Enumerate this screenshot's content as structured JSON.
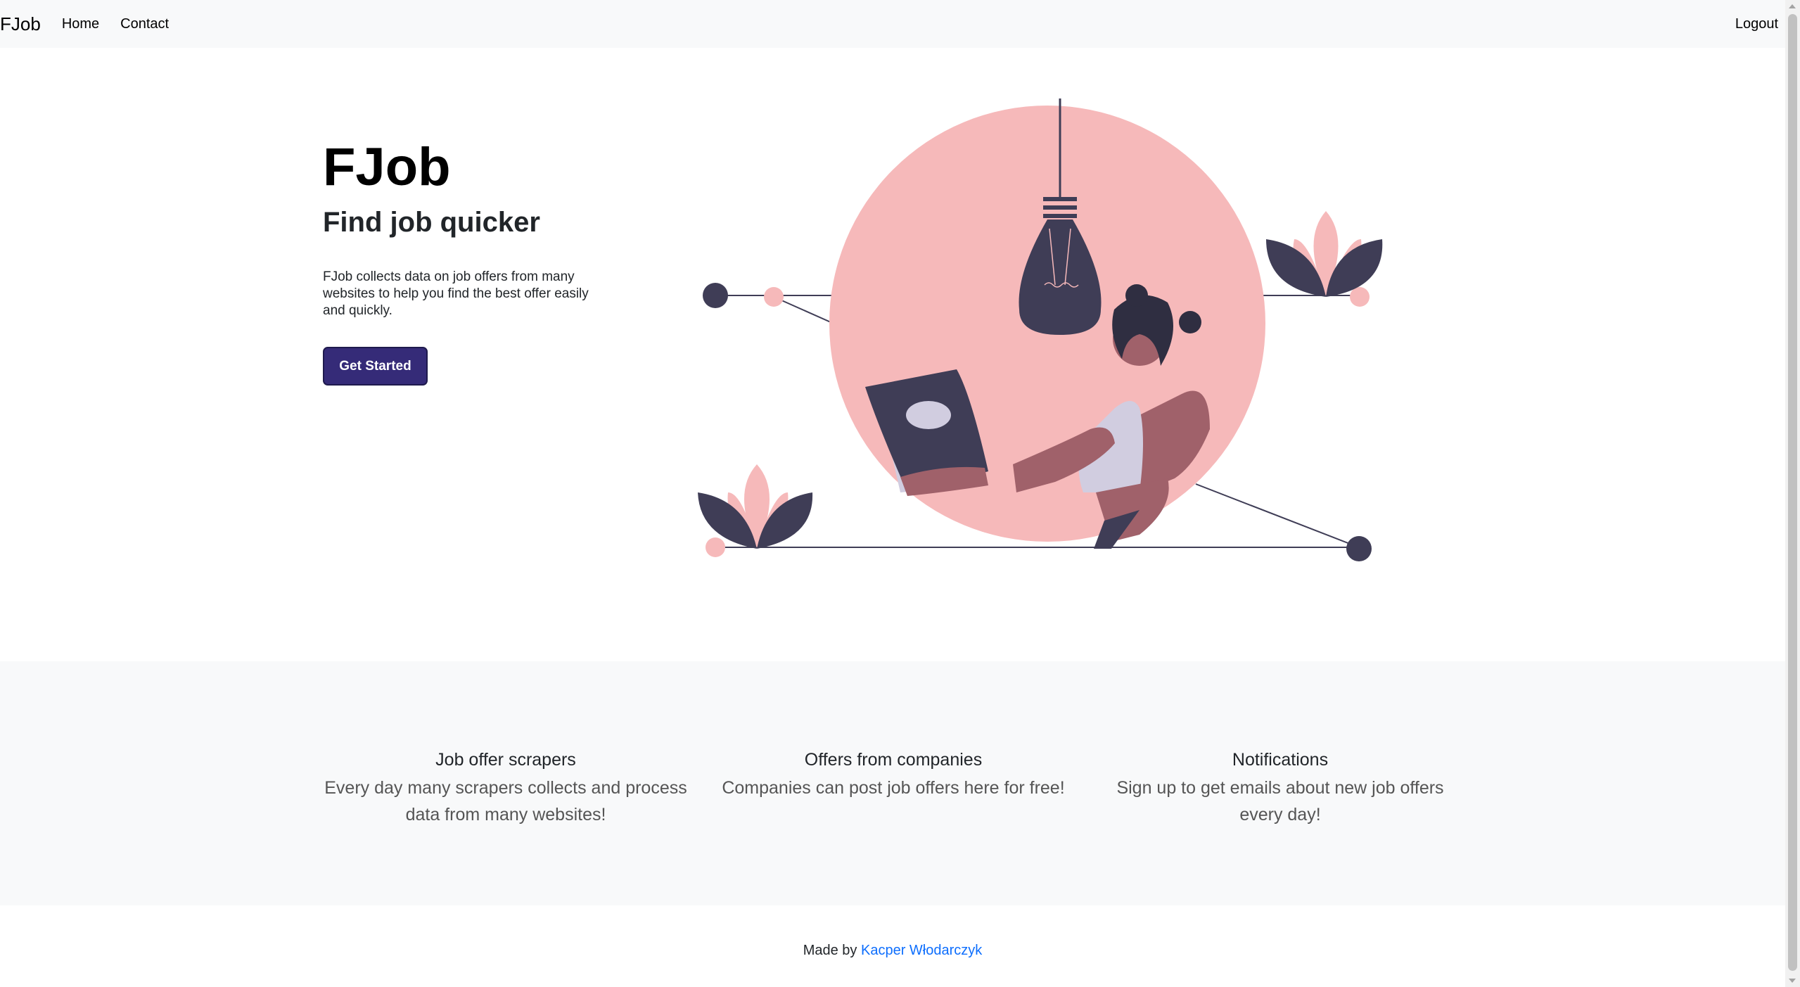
{
  "navbar": {
    "brand": "FJob",
    "links": [
      "Home",
      "Contact"
    ],
    "logout": "Logout"
  },
  "hero": {
    "title": "FJob",
    "subtitle": "Find job quicker",
    "description": "FJob collects data on job offers from many websites to help you find the best offer easily and quickly.",
    "cta_label": "Get Started"
  },
  "features": [
    {
      "title": "Job offer scrapers",
      "text": "Every day many scrapers collects and process data from many websites!"
    },
    {
      "title": "Offers from companies",
      "text": "Companies can post job offers here for free!"
    },
    {
      "title": "Notifications",
      "text": "Sign up to get emails about new job offers every day!"
    }
  ],
  "footer": {
    "prefix": "Made by",
    "author": "Kacper Włodarczyk"
  },
  "colors": {
    "accent": "#352b78",
    "illustration_pink": "#f6b9ba",
    "illustration_dark": "#3f3d56",
    "link": "#0d6efd"
  }
}
